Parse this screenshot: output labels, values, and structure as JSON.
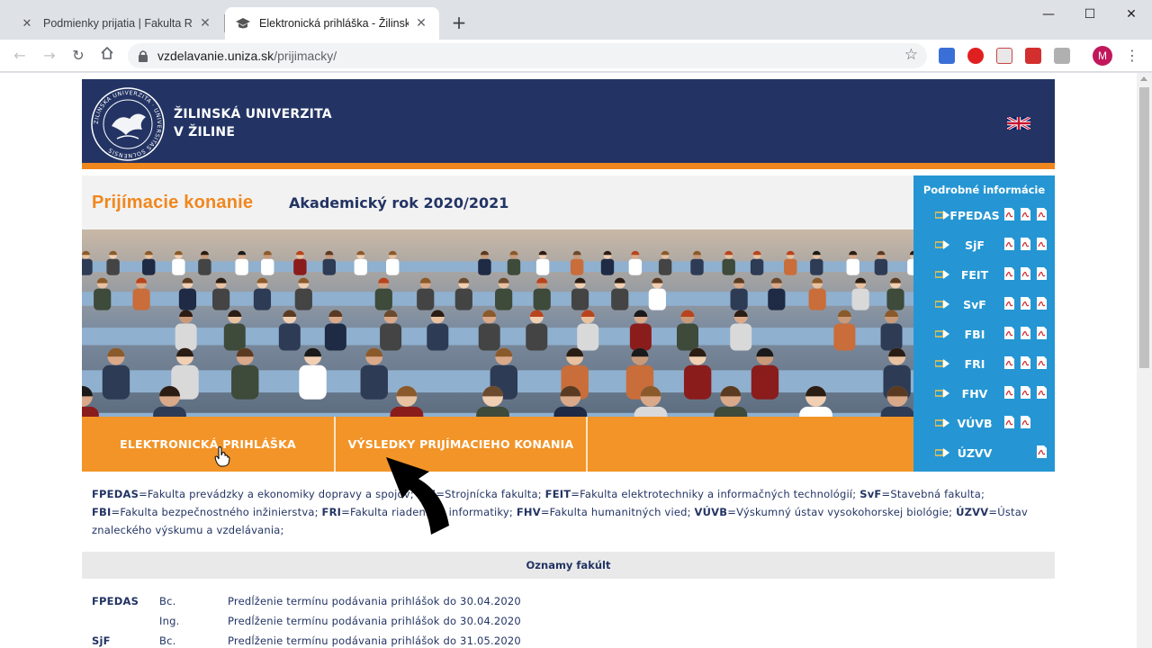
{
  "browser": {
    "tabs": [
      {
        "title": "Podmienky prijatia | Fakulta Riadenia",
        "active": false
      },
      {
        "title": "Elektronická prihláška - Žilinská univerzita",
        "active": true
      }
    ],
    "url_host": "vzdelavanie.uniza.sk",
    "url_path": "/prijimacky/",
    "profile_initial": "M"
  },
  "header": {
    "university_name_line1": "ŽILINSKÁ UNIVERZITA",
    "university_name_line2": "V ŽILINE",
    "seal_text": "ZILINSKA UNIVERZITA · UNIVERSITAS SOLNENSIS",
    "language_icon": "uk-flag-icon"
  },
  "hero": {
    "title": "Prijímacie konanie",
    "subtitle": "Akademický rok 2020/2021"
  },
  "cta": {
    "application": "ELEKTRONICKÁ PRIHLÁŠKA",
    "results": "VÝSLEDKY PRIJÍMACIEHO KONANIA"
  },
  "side_panel": {
    "title": "Podrobné informácie",
    "faculties": [
      {
        "abbr": "FPEDAS",
        "pdfs": 3
      },
      {
        "abbr": "SjF",
        "pdfs": 3
      },
      {
        "abbr": "FEIT",
        "pdfs": 3
      },
      {
        "abbr": "SvF",
        "pdfs": 3
      },
      {
        "abbr": "FBI",
        "pdfs": 3
      },
      {
        "abbr": "FRI",
        "pdfs": 3
      },
      {
        "abbr": "FHV",
        "pdfs": 3
      },
      {
        "abbr": "VÚVB",
        "pdfs": 2
      },
      {
        "abbr": "ÚZVV",
        "pdfs": 1
      }
    ]
  },
  "legend": [
    {
      "abbr": "FPEDAS",
      "name": "=Fakulta prevádzky a ekonomiky dopravy a spojov; "
    },
    {
      "abbr": "SjF",
      "name": "=Strojnícka fakulta; "
    },
    {
      "abbr": "FEIT",
      "name": "=Fakulta elektrotechniky a informačných technológií; "
    },
    {
      "abbr": "SvF",
      "name": "=Stavebná fakulta; "
    },
    {
      "abbr": "FBI",
      "name": "=Fakulta bezpečnostného inžinierstva; "
    },
    {
      "abbr": "FRI",
      "name": "=Fakulta riadenia a informatiky; "
    },
    {
      "abbr": "FHV",
      "name": "=Fakulta humanitných vied; "
    },
    {
      "abbr": "VÚVB",
      "name": "=Výskumný ústav vysokohorskej biológie; "
    },
    {
      "abbr": "ÚZVV",
      "name": "=Ústav znaleckého výskumu a vzdelávania;"
    }
  ],
  "news": {
    "heading": "Oznamy fakúlt",
    "rows": [
      {
        "faculty": "FPEDAS",
        "degree": "Bc.",
        "text": "Predĺženie termínu podávania prihlášok do 30.04.2020"
      },
      {
        "faculty": "",
        "degree": "Ing.",
        "text": "Predĺženie termínu podávania prihlášok do 30.04.2020"
      },
      {
        "faculty": "SjF",
        "degree": "Bc.",
        "text": "Predĺženie termínu podávania prihlášok do 31.05.2020"
      }
    ]
  },
  "colors": {
    "navy": "#233464",
    "orange": "#f0871e",
    "cta_orange": "#f29428",
    "side_blue": "#2596d3"
  }
}
